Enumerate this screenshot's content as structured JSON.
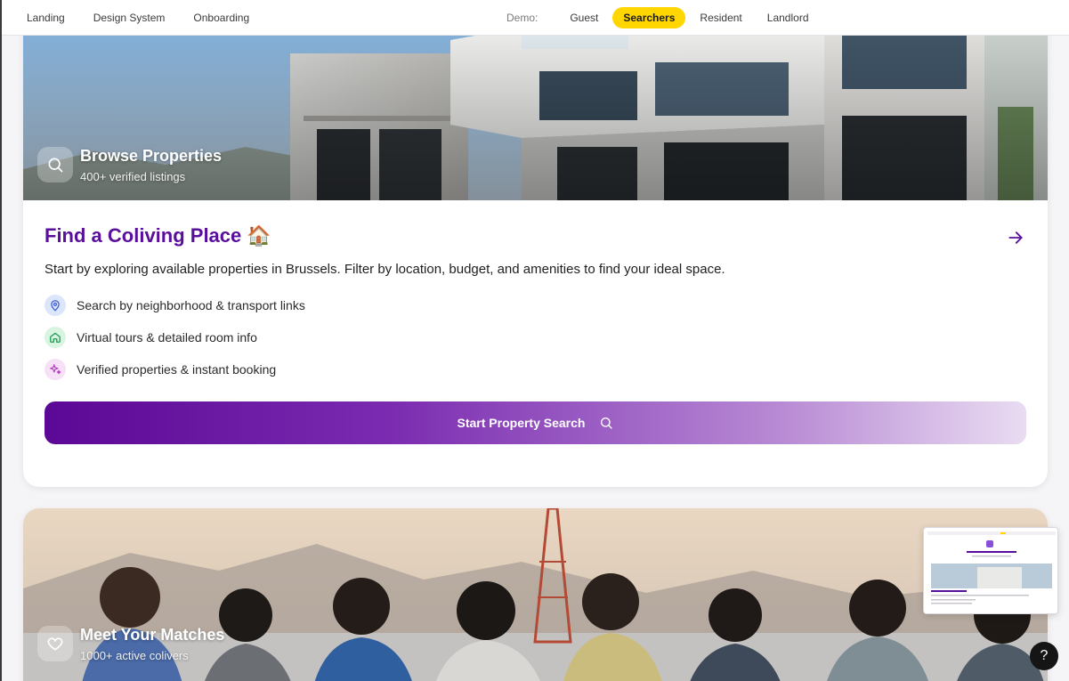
{
  "nav": {
    "links": [
      "Landing",
      "Design System",
      "Onboarding"
    ],
    "demo_label": "Demo:",
    "demo_tabs": [
      "Guest",
      "Searchers",
      "Resident",
      "Landlord"
    ],
    "active_demo_tab": "Searchers"
  },
  "card_properties": {
    "hero_title": "Browse Properties",
    "hero_subtitle": "400+ verified listings",
    "hero_icon": "search-icon",
    "title": "Find a Coliving Place 🏠",
    "description": "Start by exploring available properties in Brussels. Filter by location, budget, and amenities to find your ideal space.",
    "features": [
      {
        "icon": "map-pin-icon",
        "text": "Search by neighborhood & transport links",
        "color": "#dce6fb"
      },
      {
        "icon": "home-icon",
        "text": "Virtual tours & detailed room info",
        "color": "#d9f4e1"
      },
      {
        "icon": "sparkles-icon",
        "text": "Verified properties & instant booking",
        "color": "#f6e1f7"
      }
    ],
    "cta_label": "Start Property Search"
  },
  "card_matches": {
    "hero_title": "Meet Your Matches",
    "hero_subtitle": "1000+ active colivers",
    "hero_icon": "heart-icon"
  },
  "thumbnail": {
    "heading": "How would you like to start?",
    "card_title": "Find a Coliving Place 🏠"
  },
  "help_label": "?",
  "colors": {
    "brand_purple": "#5a0f9c",
    "active_tab_yellow": "#ffd600",
    "cta_gradient_start": "#5b0896",
    "cta_gradient_end": "#e9dcf2"
  }
}
